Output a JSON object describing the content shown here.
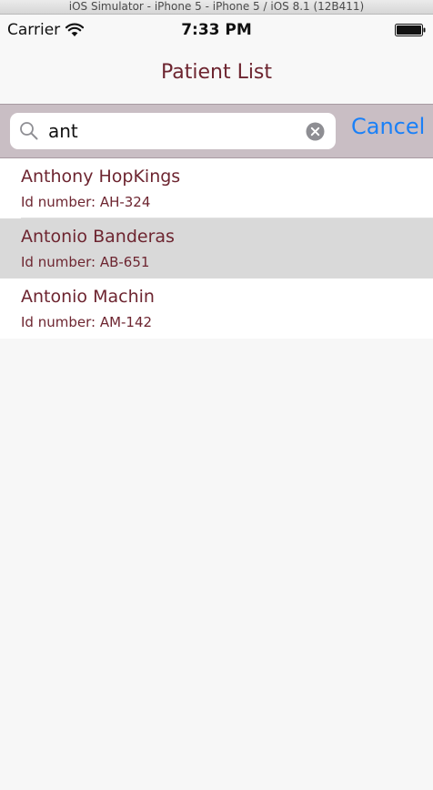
{
  "simulator": {
    "title": "iOS Simulator - iPhone 5 - iPhone 5 / iOS 8.1 (12B411)"
  },
  "status_bar": {
    "carrier": "Carrier",
    "time": "7:33 PM",
    "icons": [
      "wifi-icon",
      "battery-icon"
    ]
  },
  "nav": {
    "title": "Patient List"
  },
  "search": {
    "value": "ant",
    "cancel_label": "Cancel",
    "icons": [
      "search-icon",
      "clear-icon"
    ]
  },
  "patients": [
    {
      "name": "Anthony HopKings",
      "id_line": "Id number: AH-324",
      "selected": false
    },
    {
      "name": "Antonio Banderas",
      "id_line": "Id number: AB-651",
      "selected": true
    },
    {
      "name": "Antonio Machin",
      "id_line": "Id number: AM-142",
      "selected": false
    }
  ],
  "colors": {
    "accent": "#6d2530",
    "link": "#1a80f7",
    "search_bar_tint": "#c9bec4",
    "selected_row": "#d9d9d9",
    "background": "#f7f7f7"
  }
}
